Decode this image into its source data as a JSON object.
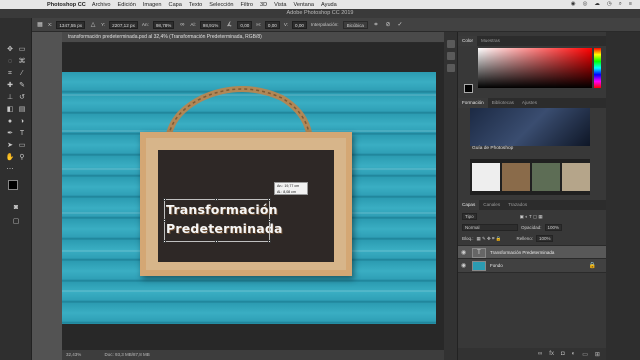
{
  "menubar": {
    "apple": "",
    "app": "Photoshop CC",
    "items": [
      "Archivo",
      "Edición",
      "Imagen",
      "Capa",
      "Texto",
      "Selección",
      "Filtro",
      "3D",
      "Vista",
      "Ventana",
      "Ayuda"
    ],
    "right_icons": [
      "◉",
      "◎",
      "☁",
      "◷",
      "⌕",
      "≡"
    ]
  },
  "window_title": "Adobe Photoshop CC 2019",
  "options": {
    "x_label": "X:",
    "x": "1347,55 px",
    "y_label": "Y:",
    "y": "2207,12 px",
    "w_label": "An:",
    "w": "98,78%",
    "h_label": "Al:",
    "h": "98,91%",
    "angle": "0,00",
    "h2_label": "H:",
    "h2": "0,00",
    "v_label": "V:",
    "v": "0,00",
    "interp_label": "Interpolación:",
    "interp": "Bicúbica"
  },
  "document": {
    "tab": "transformación predeterminada.psd al 32,4% (Transformación Predeterminada, RGB/8)",
    "line1": "Transformación",
    "line2": "Predeterminada",
    "dims_w": "An.: 19,77 cm",
    "dims_h": "Al.: 8,08 cm"
  },
  "status": {
    "zoom": "32,43%",
    "doc": "Doc: 93,3 MB/87,8 MB"
  },
  "panels": {
    "color_tabs": [
      "Color",
      "Muestras"
    ],
    "learn_tabs": [
      "Formación",
      "Bibliotecas",
      "Ajustes"
    ],
    "learn_label": "Guía de Photoshop",
    "layers_tabs": [
      "Capas",
      "Canales",
      "Trazados"
    ],
    "kind": "Tipo",
    "blend": "Normal",
    "opacity_label": "Opacidad:",
    "opacity": "100%",
    "lock_label": "Bloq.:",
    "fill_label": "Relleno:",
    "fill": "100%",
    "layers": [
      {
        "name": "Transformación Predeterminada",
        "thumb": "T"
      },
      {
        "name": "Fondo",
        "thumb": ""
      }
    ]
  },
  "colors": {
    "accent": "#2b9bb1",
    "board": "#2e2826",
    "frame": "#d4a774"
  }
}
